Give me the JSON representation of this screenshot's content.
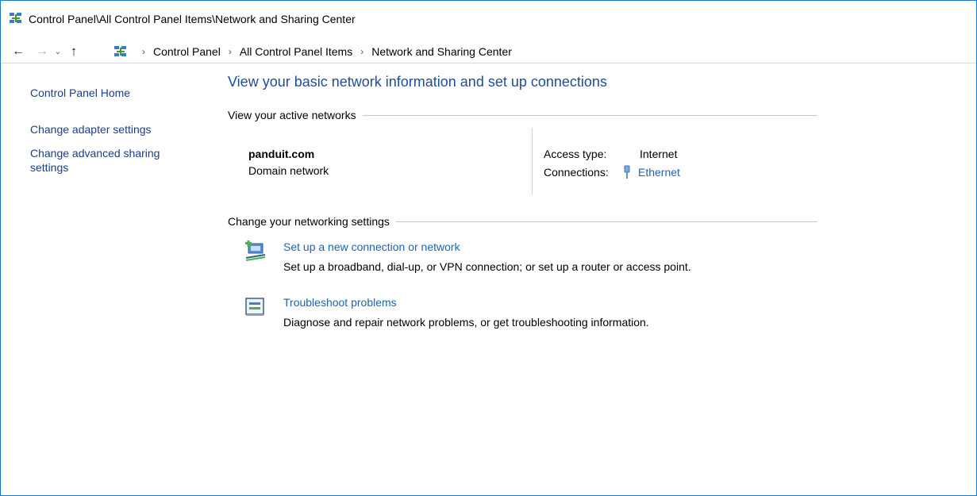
{
  "window": {
    "title": "Control Panel\\All Control Panel Items\\Network and Sharing Center"
  },
  "nav": {
    "breadcrumbs": [
      "Control Panel",
      "All Control Panel Items",
      "Network and Sharing Center"
    ],
    "separator": "›",
    "icons": {
      "back": "back-arrow-icon",
      "forward": "forward-arrow-icon",
      "recent": "chevron-down-icon",
      "up": "up-arrow-icon"
    }
  },
  "sidebar": {
    "home": "Control Panel Home",
    "links": [
      "Change adapter settings",
      "Change advanced sharing settings"
    ]
  },
  "main": {
    "heading": "View your basic network information and set up connections",
    "active_networks": {
      "header": "View your active networks",
      "network_name": "panduit.com",
      "network_type": "Domain network",
      "access_type_label": "Access type:",
      "access_type_value": "Internet",
      "connections_label": "Connections:",
      "connections_value": "Ethernet"
    },
    "change_settings": {
      "header": "Change your networking settings",
      "tasks": [
        {
          "link": "Set up a new connection or network",
          "description": "Set up a broadband, dial-up, or VPN connection; or set up a router or access point.",
          "icon": "new-connection-icon"
        },
        {
          "link": "Troubleshoot problems",
          "description": "Diagnose and repair network problems, or get troubleshooting information.",
          "icon": "troubleshoot-icon"
        }
      ]
    }
  },
  "colors": {
    "window_border": "#1979ca",
    "link": "#1b63b8",
    "heading": "#1e4d9a",
    "nav_link": "#1a3e8c"
  }
}
